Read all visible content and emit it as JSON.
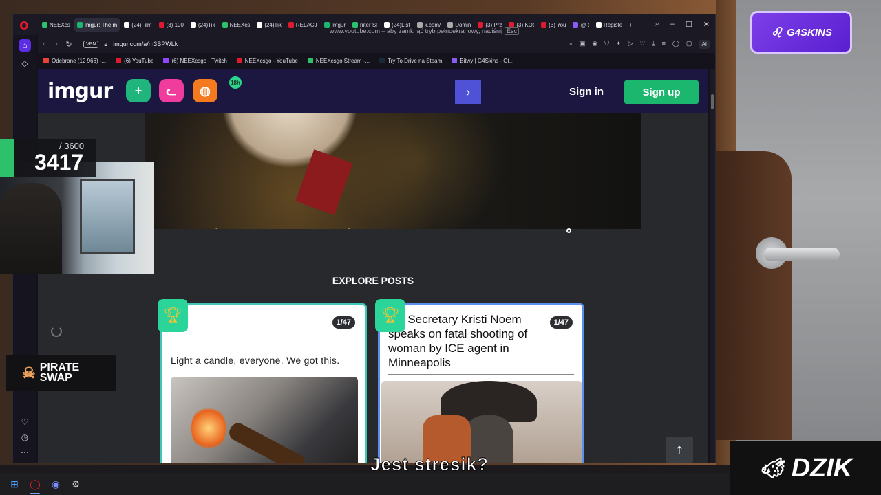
{
  "browser": {
    "tabs": [
      {
        "label": "NEEXcs",
        "color": "#2ec16b"
      },
      {
        "label": "Imgur: The m",
        "color": "#1bb76e",
        "active": true
      },
      {
        "label": "(24)Film",
        "color": "#ffffff"
      },
      {
        "label": "(3) 100",
        "color": "#e0192e"
      },
      {
        "label": "(24)Tik",
        "color": "#ffffff"
      },
      {
        "label": "NEEXcs",
        "color": "#2ec16b"
      },
      {
        "label": "(24)Tik",
        "color": "#ffffff"
      },
      {
        "label": "RELACJ",
        "color": "#e0192e"
      },
      {
        "label": "Imgur",
        "color": "#1bb76e"
      },
      {
        "label": "niter Sl",
        "color": "#2ec16b"
      },
      {
        "label": "(24)List",
        "color": "#ffffff"
      },
      {
        "label": "x.com/",
        "color": "#aaaaaa"
      },
      {
        "label": "Domin",
        "color": "#aaaaaa"
      },
      {
        "label": "(3) Prz",
        "color": "#e0192e"
      },
      {
        "label": "(3) KOt",
        "color": "#e0192e"
      },
      {
        "label": "(3) You",
        "color": "#e0192e"
      },
      {
        "label": "@ t",
        "color": "#8b5cf6"
      },
      {
        "label": "Registe",
        "color": "#ffffff"
      }
    ],
    "fullscreen_notice": "www.youtube.com – aby zamknąć tryb pełnoekranowy, naciśnij",
    "fullscreen_key": "Esc",
    "vpn_label": "VPN",
    "url": "imgur.com/a/m3BPWLk",
    "ai_label": "AI",
    "bookmarks": [
      {
        "label": "Odebrane (12 966) -...",
        "color": "#ea4335"
      },
      {
        "label": "(6) YouTube",
        "color": "#e0192e"
      },
      {
        "label": "(6) NEEXcsgo - Twitch",
        "color": "#9146ff"
      },
      {
        "label": "NEEXcsgo - YouTube",
        "color": "#e0192e"
      },
      {
        "label": "NEEXcsgo Stream -...",
        "color": "#2ec16b"
      },
      {
        "label": "Try To Drive na Steam",
        "color": "#1b2838"
      },
      {
        "label": "Bitwy | G4Skins - Ot...",
        "color": "#8b5cf6"
      }
    ]
  },
  "imgur": {
    "logo": "imgur",
    "new_post_icon": "+",
    "age_badge": "18h",
    "next_icon": "›",
    "sign_in": "Sign in",
    "sign_up": "Sign up",
    "explore_title": "EXPLORE POSTS",
    "cards": [
      {
        "count": "1/47",
        "caption": "Light a candle, everyone. We got this."
      },
      {
        "count": "1/47",
        "headline": "US Secretary Kristi Noem speaks on fatal shooting of woman by ICE agent in Minneapolis"
      }
    ],
    "scroll_top_icon": "⤒"
  },
  "overlays": {
    "g4skins": "G4SKINS",
    "counter_max": "/ 3600",
    "counter_value": "3417",
    "pirate": [
      "PIRATE",
      "SWAP"
    ],
    "dzik": "DZIK",
    "subtitle": "Jest stresik?"
  },
  "colors": {
    "imgur_header": "#1b1740",
    "imgur_green": "#1bb76e",
    "opera_red": "#e0192e",
    "g4_purple": "#7c3fe8"
  }
}
